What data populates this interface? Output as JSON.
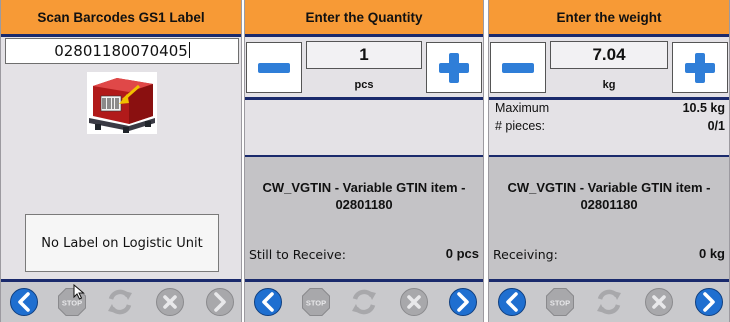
{
  "screens": [
    {
      "title": "Scan Barcodes GS1 Label",
      "barcode_value": "02801180070405",
      "no_label_button": "No Label on Logistic Unit",
      "toolbar": [
        "back-arrow-icon",
        "stop-icon",
        "refresh-icon",
        "cancel-icon",
        "forward-arrow-icon"
      ]
    },
    {
      "title": "Enter the Quantity",
      "value": "1",
      "unit": "pcs",
      "item_title_line1": "CW_VGTIN - Variable GTIN item -",
      "item_title_line2": "02801180",
      "status_label": "Still to Receive:",
      "status_value": "0 pcs",
      "toolbar": [
        "back-arrow-icon",
        "stop-icon",
        "refresh-icon",
        "cancel-icon",
        "forward-arrow-icon"
      ]
    },
    {
      "title": "Enter the weight",
      "value": "7.04",
      "unit": "kg",
      "maximum_label": "Maximum",
      "maximum_value": "10.5 kg",
      "pieces_label": "# pieces:",
      "pieces_value": "0/1",
      "item_title_line1": "CW_VGTIN - Variable GTIN item -",
      "item_title_line2": "02801180",
      "status_label": "Receiving:",
      "status_value": "0 kg",
      "toolbar": [
        "back-arrow-icon",
        "stop-icon",
        "refresh-icon",
        "cancel-icon",
        "forward-arrow-icon"
      ]
    }
  ],
  "stop_icon_text": "STOP",
  "colors": {
    "header": "#f79a36",
    "divider": "#1a2a6c",
    "nav_blue": "#1f6fd0",
    "disabled_gray": "#a8a8ab"
  }
}
